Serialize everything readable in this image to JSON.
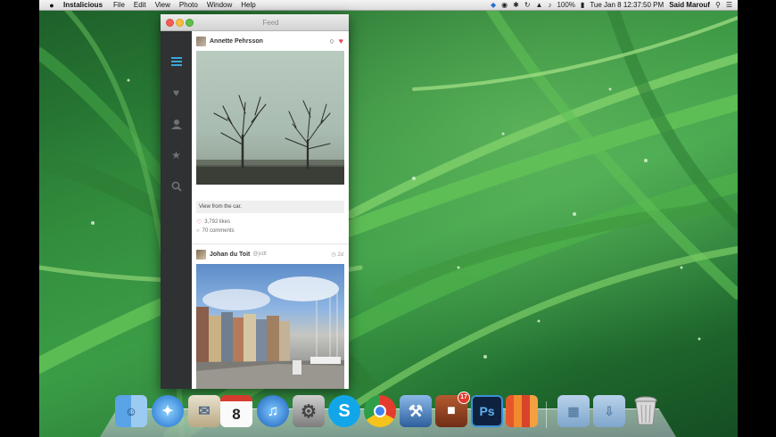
{
  "menubar": {
    "app_name": "Instalicious",
    "menus": [
      "File",
      "Edit",
      "View",
      "Photo",
      "Window",
      "Help"
    ],
    "battery": "100%",
    "clock": "Tue Jan 8  12:37:50 PM",
    "user": "Said Marouf"
  },
  "window": {
    "title": "Feed"
  },
  "sidebar": {
    "items": [
      {
        "icon": "feed-icon",
        "active": true
      },
      {
        "icon": "heart-icon",
        "active": false
      },
      {
        "icon": "user-icon",
        "active": false
      },
      {
        "icon": "star-icon",
        "active": false
      },
      {
        "icon": "search-icon",
        "active": false
      }
    ]
  },
  "feed": {
    "posts": [
      {
        "author": "Annette Pehrsson",
        "caption": "View from the car.",
        "likes": "3,792 likes",
        "comments": "70 comments"
      },
      {
        "author": "Johan du Toit",
        "handle": "@jvdt",
        "age": "2d"
      }
    ]
  },
  "dock": {
    "items": [
      {
        "name": "Finder",
        "icon": "finder-icon"
      },
      {
        "name": "Safari",
        "icon": "safari-icon"
      },
      {
        "name": "Mail",
        "icon": "mail-icon"
      },
      {
        "name": "Calendar",
        "icon": "calendar-icon",
        "label": "8"
      },
      {
        "name": "iTunes",
        "icon": "itunes-icon"
      },
      {
        "name": "System Preferences",
        "icon": "gear-icon"
      },
      {
        "name": "Skype",
        "icon": "skype-icon",
        "label": "S"
      },
      {
        "name": "Chrome",
        "icon": "chrome-icon"
      },
      {
        "name": "Xcode",
        "icon": "xcode-icon"
      },
      {
        "name": "Instalicious",
        "icon": "instalicious-icon",
        "badge": "17"
      },
      {
        "name": "Photoshop",
        "icon": "photoshop-icon",
        "label": "Ps"
      },
      {
        "name": "Books",
        "icon": "books-icon"
      },
      {
        "name": "Applications",
        "icon": "folder-icon"
      },
      {
        "name": "Downloads",
        "icon": "downloads-folder-icon"
      },
      {
        "name": "Trash",
        "icon": "trash-icon"
      }
    ]
  },
  "colors": {
    "sidebar_bg": "#2f3133",
    "sidebar_active": "#39a7dd",
    "like_heart": "#e34a55"
  }
}
